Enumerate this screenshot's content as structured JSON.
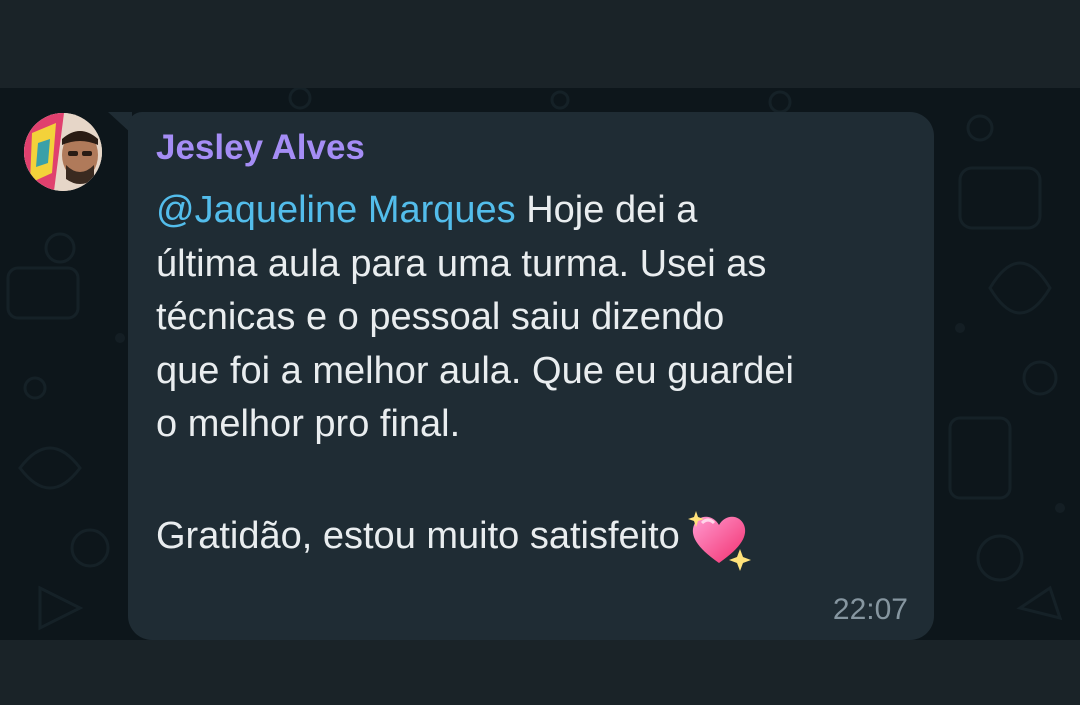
{
  "message": {
    "sender": "Jesley Alves",
    "mention": "@Jaqueline Marques",
    "line1_rest": " Hoje dei a",
    "line2": "última aula para uma turma. Usei as",
    "line3": "técnicas e o pessoal saiu dizendo",
    "line4": "que foi a melhor aula. Que eu guardei",
    "line5": "o melhor pro final.",
    "line7": "Gratidão, estou muito satisfeito",
    "emoji": "sparkling-heart-icon",
    "time": "22:07"
  },
  "colors": {
    "background": "#0d161b",
    "bubble": "#1f2c34",
    "sender": "#a58df5",
    "mention": "#53bdeb",
    "text": "#e9edef",
    "timestamp": "#8696a0"
  }
}
